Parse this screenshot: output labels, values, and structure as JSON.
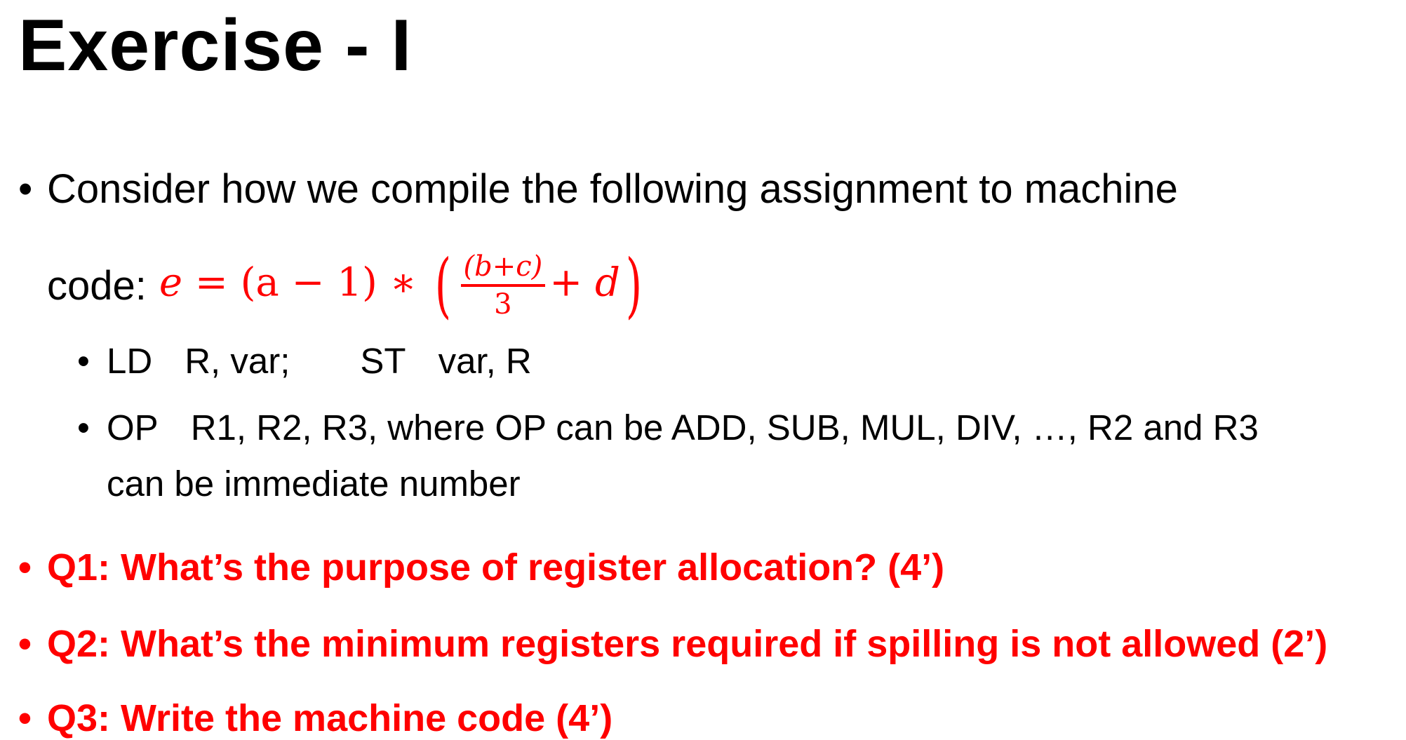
{
  "title": "Exercise - I",
  "bullets": {
    "intro_line1": "Consider how we compile the following assignment to machine",
    "intro_line2_prefix": "code:",
    "formula": {
      "lhs": "e",
      "eq": "=",
      "paren_a": "(a − 1)",
      "times": "∗",
      "numerator": "(b+c)",
      "denominator": "3",
      "plus_d": "+ d"
    },
    "sub1": {
      "ld": "LD",
      "ld_args": "R, var;",
      "st": "ST",
      "st_args": "var, R"
    },
    "sub2": {
      "op": "OP",
      "line1": "R1, R2, R3, where OP can be ADD, SUB, MUL, DIV, …, R2 and R3",
      "line2": "can be immediate number"
    },
    "q1": "Q1: What’s the purpose of register allocation? (4’)",
    "q2": "Q2: What’s the minimum registers required if spilling is not allowed (2’)",
    "q3": "Q3: Write the machine code (4’)"
  },
  "colors": {
    "accent": "#ff0000"
  }
}
